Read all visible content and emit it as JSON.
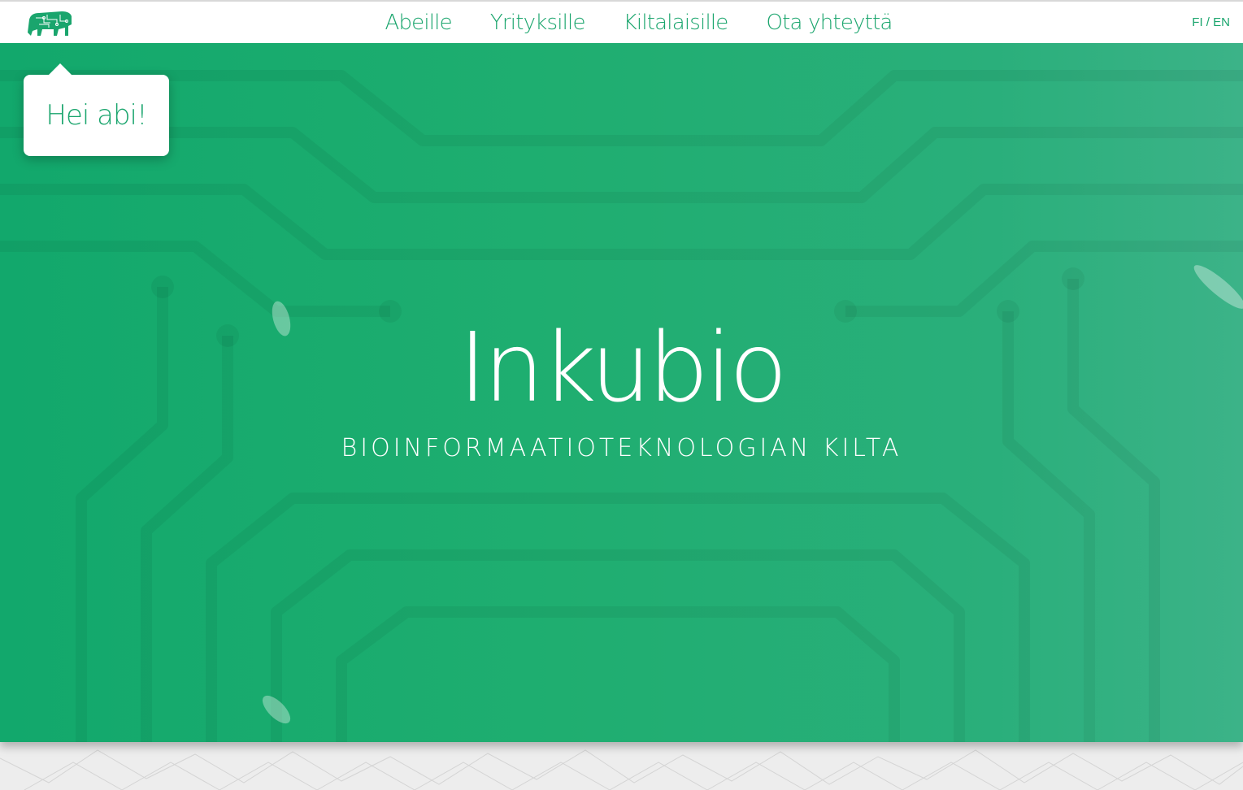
{
  "header": {
    "nav": [
      {
        "label": "Abeille"
      },
      {
        "label": "Yrityksille"
      },
      {
        "label": "Kiltalaisille"
      },
      {
        "label": "Ota yhteyttä"
      }
    ],
    "lang_fi": "FI",
    "lang_sep": " / ",
    "lang_en": "EN"
  },
  "bubble": {
    "text": "Hei abi!"
  },
  "hero": {
    "title": "Inkubio",
    "subtitle": "BIOINFORMAATIOTEKNOLOGIAN KILTA"
  },
  "colors": {
    "accent": "#1aa56d",
    "hero_start": "#12a86c",
    "hero_end": "#3cb388"
  }
}
